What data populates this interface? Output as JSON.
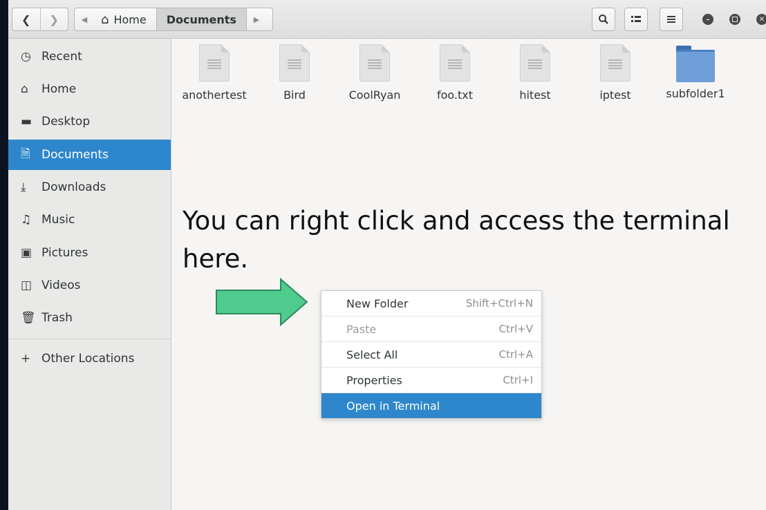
{
  "header": {
    "back_icon": "chevron-left",
    "forward_icon": "chevron-right",
    "breadcrumbs": [
      {
        "label": "Home",
        "icon": "home"
      },
      {
        "label": "Documents"
      }
    ],
    "search_icon": "search",
    "view_icon": "view-toggle",
    "menu_icon": "hamburger"
  },
  "sidebar": {
    "items": [
      {
        "label": "Recent",
        "icon": "clock"
      },
      {
        "label": "Home",
        "icon": "home"
      },
      {
        "label": "Desktop",
        "icon": "folder"
      },
      {
        "label": "Documents",
        "icon": "document"
      },
      {
        "label": "Downloads",
        "icon": "download"
      },
      {
        "label": "Music",
        "icon": "music-note"
      },
      {
        "label": "Pictures",
        "icon": "picture"
      },
      {
        "label": "Videos",
        "icon": "film"
      },
      {
        "label": "Trash",
        "icon": "trash"
      },
      {
        "label": "Other Locations",
        "icon": "plus"
      }
    ],
    "selected": "Documents"
  },
  "files": [
    {
      "name": "anothertest",
      "type": "document"
    },
    {
      "name": "Bird",
      "type": "document"
    },
    {
      "name": "CoolRyan",
      "type": "document"
    },
    {
      "name": "foo.txt",
      "type": "document"
    },
    {
      "name": "hitest",
      "type": "document"
    },
    {
      "name": "iptest",
      "type": "document"
    },
    {
      "name": "subfolder1",
      "type": "folder"
    }
  ],
  "annotation": {
    "text": "You can right click and access the terminal here."
  },
  "context_menu": {
    "items": [
      {
        "label": "New Folder",
        "shortcut": "Shift+Ctrl+N"
      },
      {
        "label": "Paste",
        "shortcut": "Ctrl+V"
      },
      {
        "label": "Select All",
        "shortcut": "Ctrl+A"
      },
      {
        "label": "Properties",
        "shortcut": "Ctrl+I"
      },
      {
        "label": "Open in Terminal",
        "shortcut": ""
      }
    ]
  },
  "colors": {
    "selection": "#2e87cc",
    "arrow_fill": "#4ecb8d",
    "arrow_stroke": "#2e8a5c"
  }
}
